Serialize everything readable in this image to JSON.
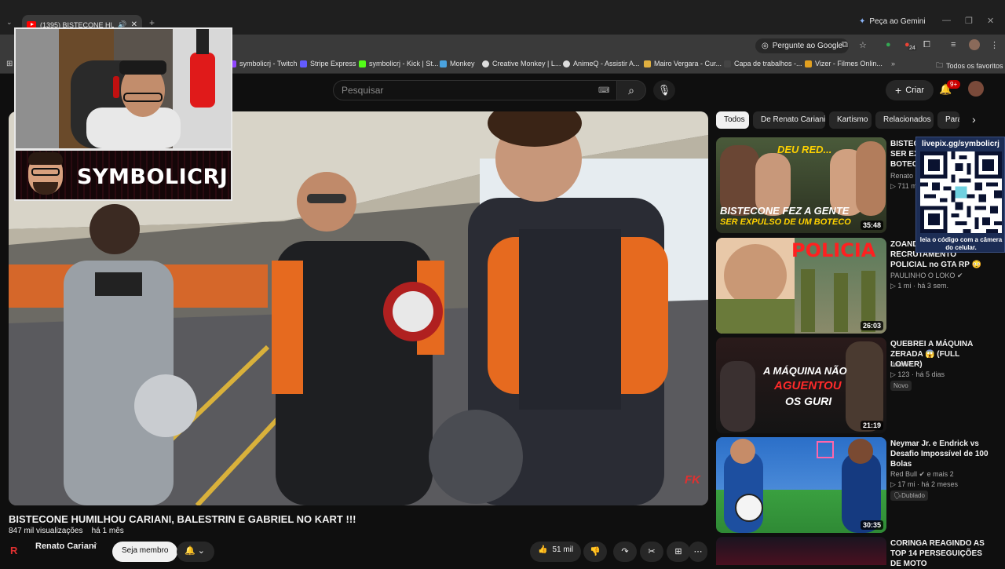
{
  "browser": {
    "tab_title": "(1395) BISTECONE HUMILH",
    "gemini_label": "Peça ao Gemini",
    "address_pill": "Pergunte ao Google",
    "extension_badge": "24",
    "bookmarks": [
      {
        "label": "symbolicrj - Twitch",
        "icon": "twitch-icon",
        "color": "#9146ff"
      },
      {
        "label": "Stripe Express",
        "icon": "stripe-icon",
        "color": "#635bff"
      },
      {
        "label": "symbolicrj - Kick | St...",
        "icon": "kick-icon",
        "color": "#53fc18"
      },
      {
        "label": "Monkey",
        "icon": "monkey-icon",
        "color": "#4aa3df"
      },
      {
        "label": "Creative Monkey | L...",
        "icon": "globe-icon",
        "color": "#dddddd"
      },
      {
        "label": "AnimeQ - Assistir A...",
        "icon": "globe-icon",
        "color": "#dddddd"
      },
      {
        "label": "Mairo Vergara - Cur...",
        "icon": "mv-icon",
        "color": "#e0b040"
      },
      {
        "label": "Capa de trabalhos -...",
        "icon": "doc-icon",
        "color": "#444444"
      },
      {
        "label": "Vizer - Filmes Onlin...",
        "icon": "vizer-icon",
        "color": "#e2a020"
      }
    ],
    "all_bookmarks": "Todos os favoritos"
  },
  "youtube": {
    "search_placeholder": "Pesquisar",
    "create_label": "Criar",
    "notification_count": "9+",
    "video": {
      "title": "BISTECONE HUMILHOU CARIANI, BALESTRIN E GABRIEL NO KART !!!",
      "views": "847 mil visualizações",
      "age": "há 1 mês",
      "channel": "Renato Cariani",
      "join_label": "Seja membro",
      "likes": "51 mil",
      "watermark": "FK"
    },
    "chips": [
      "Todos",
      "De Renato Cariani",
      "Kartismo",
      "Relacionados",
      "Para"
    ],
    "recommendations": [
      {
        "title": "BISTECONE FEZ A GENTE SER EXPULSO DE UM BOTECO",
        "channel": "Renato C",
        "stats": "711 m",
        "duration": "35:48",
        "thumb_text_top": "DEU RED...",
        "thumb_text_bottom_1": "BISTECONE FEZ A GENTE",
        "thumb_text_bottom_2": "SER EXPULSO DE UM BOTECO"
      },
      {
        "title": "ZOANDO NO RECRUTAMENTO POLICIAL no GTA RP 😳 (Paulinho o ...",
        "channel": "PAULINHO O LOKO",
        "stats": "1 mi · há 3 sem.",
        "duration": "26:03",
        "thumb_text_top": "POLICIA"
      },
      {
        "title": "QUEBREI A MÁQUINA ZERADA 😱 (FULL LOWER)",
        "channel": "doardo",
        "stats": "123 · há 5 dias",
        "badge": "Novo",
        "duration": "21:19",
        "thumb_text_1": "A MÁQUINA NÃO",
        "thumb_text_2": "AGUENTOU",
        "thumb_text_3": "OS GURI"
      },
      {
        "title": "Neymar Jr. e Endrick vs Desafio Impossível de 100 Bolas",
        "channel": "Red Bull",
        "channel_extra": "e mais 2",
        "stats": "17 mi · há 2 meses",
        "badge": "Dublado",
        "duration": "30:35"
      },
      {
        "title": "CORINGA REAGINDO AS TOP 14 PERSEGUIÇÕES DE MOTO"
      }
    ]
  },
  "overlays": {
    "streamer_name": "SYMBOLICRJ",
    "qr_url": "livepix.gg/symbolicrj",
    "qr_caption": "leia o código com a câmera do celular."
  },
  "colors": {
    "yt_background": "#0f0f0f",
    "chip_active": "#f1f1f1",
    "qr_panel": "#1c2d55",
    "accent_red": "#ff0000"
  }
}
